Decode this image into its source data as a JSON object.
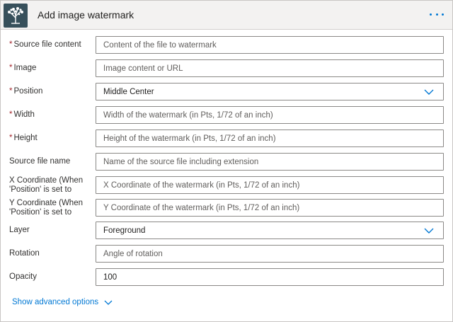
{
  "header": {
    "title": "Add image watermark",
    "logo_icon": "tree-logo-icon",
    "menu_icon": "more-options-icon",
    "accent": "#0078d4"
  },
  "fields": {
    "source_file_content": {
      "label": "Source file content",
      "required": true,
      "placeholder": "Content of the file to watermark"
    },
    "image": {
      "label": "Image",
      "required": true,
      "placeholder": "Image content or URL"
    },
    "position": {
      "label": "Position",
      "required": true,
      "value": "Middle Center"
    },
    "width": {
      "label": "Width",
      "required": true,
      "placeholder": "Width of the watermark (in Pts, 1/72 of an inch)"
    },
    "height": {
      "label": "Height",
      "required": true,
      "placeholder": "Height of the watermark (in Pts, 1/72 of an inch)"
    },
    "source_file_name": {
      "label": "Source file name",
      "required": false,
      "placeholder": "Name of the source file including extension"
    },
    "x_coordinate": {
      "label_line1": "X Coordinate (When",
      "label_line2": "'Position' is set to",
      "required": false,
      "placeholder": "X Coordinate of the watermark (in Pts, 1/72 of an inch)"
    },
    "y_coordinate": {
      "label_line1": "Y Coordinate (When",
      "label_line2": "'Position' is set to",
      "required": false,
      "placeholder": "Y Coordinate of the watermark (in Pts, 1/72 of an inch)"
    },
    "layer": {
      "label": "Layer",
      "required": false,
      "value": "Foreground"
    },
    "rotation": {
      "label": "Rotation",
      "required": false,
      "placeholder": "Angle of rotation"
    },
    "opacity": {
      "label": "Opacity",
      "required": false,
      "value": "100"
    }
  },
  "required_marker": "*",
  "footer": {
    "advanced_label": "Show advanced options"
  }
}
